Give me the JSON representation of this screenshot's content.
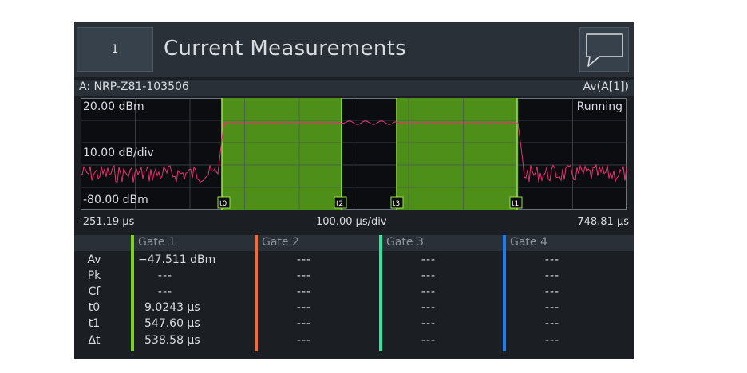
{
  "header": {
    "window_number": "1",
    "title": "Current Measurements",
    "message_icon": "speech-bubble-icon"
  },
  "info": {
    "sensor": "A: NRP-Z81-103506",
    "measurement": "Av(A[1])"
  },
  "trace": {
    "ref_level": "20.00 dBm",
    "scale": "10.00 dB/div",
    "bottom_level": "-80.00 dBm",
    "status": "Running",
    "markers": [
      "t0",
      "t2",
      "t3",
      "t1"
    ],
    "gate_color": "#4e8f1a",
    "trace_color": "#e6336e"
  },
  "timebase": {
    "start": "-251.19 µs",
    "per_div": "100.00 µs/div",
    "end": "748.81 µs"
  },
  "gates": [
    {
      "label": "Gate 1",
      "color": "#7ed321"
    },
    {
      "label": "Gate 2",
      "color": "#f06d3a"
    },
    {
      "label": "Gate 3",
      "color": "#2ee6a0"
    },
    {
      "label": "Gate 4",
      "color": "#1e7cf0"
    }
  ],
  "rows": [
    {
      "label": "Av",
      "gate1": "−47.511 dBm",
      "others": "---"
    },
    {
      "label": "Pk",
      "gate1": "---",
      "others": "---"
    },
    {
      "label": "Cf",
      "gate1": "---",
      "others": "---"
    },
    {
      "label": "t0",
      "gate1": "9.0243 µs",
      "others": "---"
    },
    {
      "label": "t1",
      "gate1": "547.60 µs",
      "others": "---"
    },
    {
      "label": "Δt",
      "gate1": "538.58 µs",
      "others": "---"
    }
  ]
}
